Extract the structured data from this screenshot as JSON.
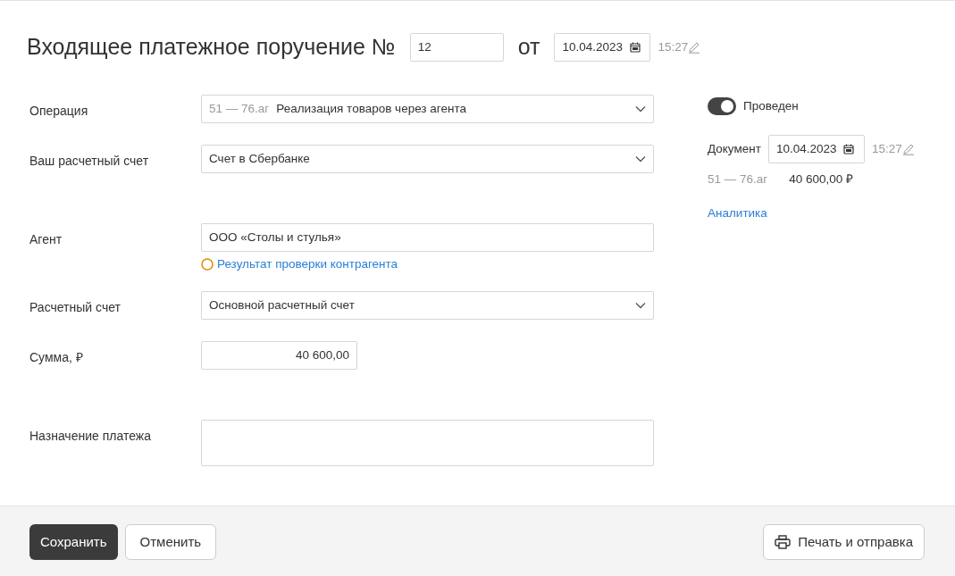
{
  "header": {
    "title": "Входящее платежное поручение №",
    "number": "12",
    "from_label": "от",
    "date": "10.04.2023",
    "time": "15:27"
  },
  "field_groups": [
    {
      "fields": [
        {
          "kind": "select",
          "label": "Операция",
          "prefix": "51 — 76.аг",
          "value": "Реализация товаров через агента"
        },
        {
          "kind": "select",
          "label": "Ваш расчетный счет",
          "value": "Счет в Сбербанке"
        }
      ]
    },
    {
      "fields": [
        {
          "kind": "input",
          "label": "Агент",
          "value": "ООО «Столы и стулья»",
          "check_link": "Результат проверки контрагента"
        },
        {
          "kind": "select",
          "label": "Расчетный счет",
          "value": "Основной расчетный счет"
        },
        {
          "kind": "amount",
          "label": "Сумма, ₽",
          "value": "40 600,00"
        }
      ]
    },
    {
      "fields": [
        {
          "kind": "textarea",
          "label": "Назначение платежа"
        }
      ]
    }
  ],
  "side": {
    "posted": {
      "label": "Проведен",
      "on": true
    },
    "document": {
      "label": "Документ",
      "date": "10.04.2023",
      "time": "15:27"
    },
    "entry": {
      "account": "51 — 76.аг",
      "amount": "40 600,00 ₽"
    },
    "analytics_link": "Аналитика"
  },
  "footer": {
    "save": "Сохранить",
    "cancel": "Отменить",
    "print": "Печать и отправка"
  }
}
